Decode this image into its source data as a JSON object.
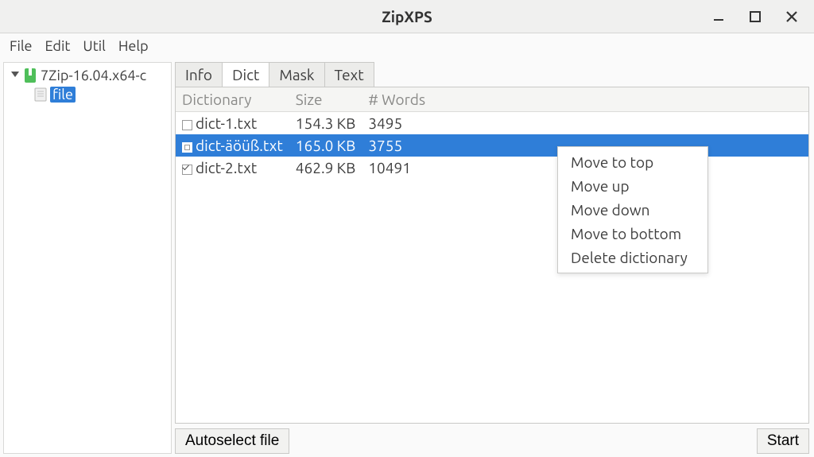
{
  "window": {
    "title": "ZipXPS"
  },
  "menubar": [
    "File",
    "Edit",
    "Util",
    "Help"
  ],
  "tree": {
    "root_label": "7Zip-16.04.x64-c",
    "child_label": "file"
  },
  "tabs": {
    "items": [
      "Info",
      "Dict",
      "Mask",
      "Text"
    ],
    "active_index": 1
  },
  "table": {
    "headers": {
      "name": "Dictionary",
      "size": "Size",
      "words": "# Words"
    },
    "rows": [
      {
        "name": "dict-1.txt",
        "size": "154.3 KB",
        "words": "3495",
        "checked": false,
        "selected": false
      },
      {
        "name": "dict-äöüß.txt",
        "size": "165.0 KB",
        "words": "3755",
        "checked": false,
        "selected": true
      },
      {
        "name": "dict-2.txt",
        "size": "462.9 KB",
        "words": "10491",
        "checked": true,
        "selected": false
      }
    ]
  },
  "context_menu": [
    "Move to top",
    "Move up",
    "Move down",
    "Move to bottom",
    "Delete dictionary"
  ],
  "buttons": {
    "autoselect": "Autoselect file",
    "start": "Start"
  }
}
